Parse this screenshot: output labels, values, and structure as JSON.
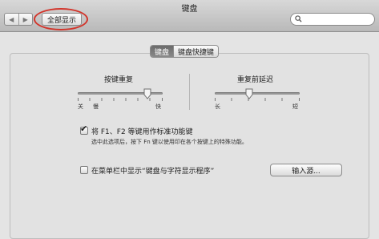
{
  "window": {
    "title": "键盘"
  },
  "toolbar": {
    "back_icon": "◀",
    "forward_icon": "▶",
    "show_all_label": "全部显示",
    "search_value": ""
  },
  "tabs": [
    {
      "label": "键盘",
      "active": true
    },
    {
      "label": "键盘快捷键",
      "active": false
    }
  ],
  "sliders": {
    "key_repeat": {
      "label": "按键重复",
      "left_label": "关",
      "mid_label": "慢",
      "right_label": "快",
      "value": 0.85
    },
    "delay_until_repeat": {
      "label": "重复前延迟",
      "left_label": "长",
      "right_label": "短",
      "value": 0.4
    }
  },
  "options": {
    "fn_keys": {
      "checked": true,
      "label": "将 F1、F2 等键用作标准功能键",
      "description": "选中此选项后，按下 Fn 键以使用印在各个按键上的特殊功能。"
    },
    "menu_bar": {
      "checked": false,
      "label": "在菜单栏中显示“键盘与字符显示程序”"
    }
  },
  "buttons": {
    "input_sources": "输入源..."
  },
  "colors": {
    "highlight_oval": "#d2352b",
    "active_tab_bg": "#7a7a7a"
  }
}
